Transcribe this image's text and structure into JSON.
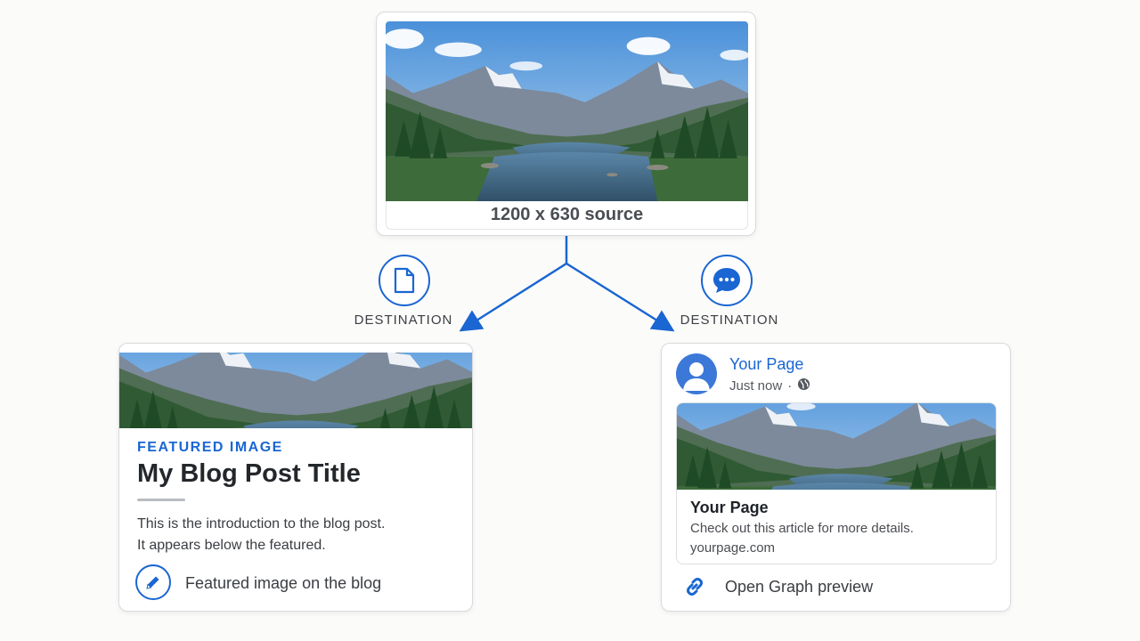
{
  "source": {
    "caption": "1200 x 630 source",
    "image_icon": "mountain-lake-landscape"
  },
  "destinations": {
    "left": {
      "label": "DESTINATION",
      "icon": "document-icon"
    },
    "right": {
      "label": "DESTINATION",
      "icon": "chat-bubble-icon"
    }
  },
  "blog": {
    "kicker": "FEATURED IMAGE",
    "title": "My Blog Post Title",
    "intro_line1": "This is the introduction to the blog post.",
    "intro_line2": "It appears below the featured.",
    "footer_label": "Featured image on the blog",
    "footer_icon": "pencil-icon"
  },
  "social": {
    "page_name": "Your Page",
    "timestamp": "Just now",
    "separator": "·",
    "privacy_icon": "globe-icon",
    "preview": {
      "title": "Your Page",
      "description": "Check out this article for more details.",
      "domain": "yourpage.com"
    },
    "footer_label": "Open Graph preview",
    "footer_icon": "link-icon"
  },
  "colors": {
    "accent": "#1a66d2",
    "background": "#fbfbf9",
    "card_border": "#d8dadd"
  }
}
